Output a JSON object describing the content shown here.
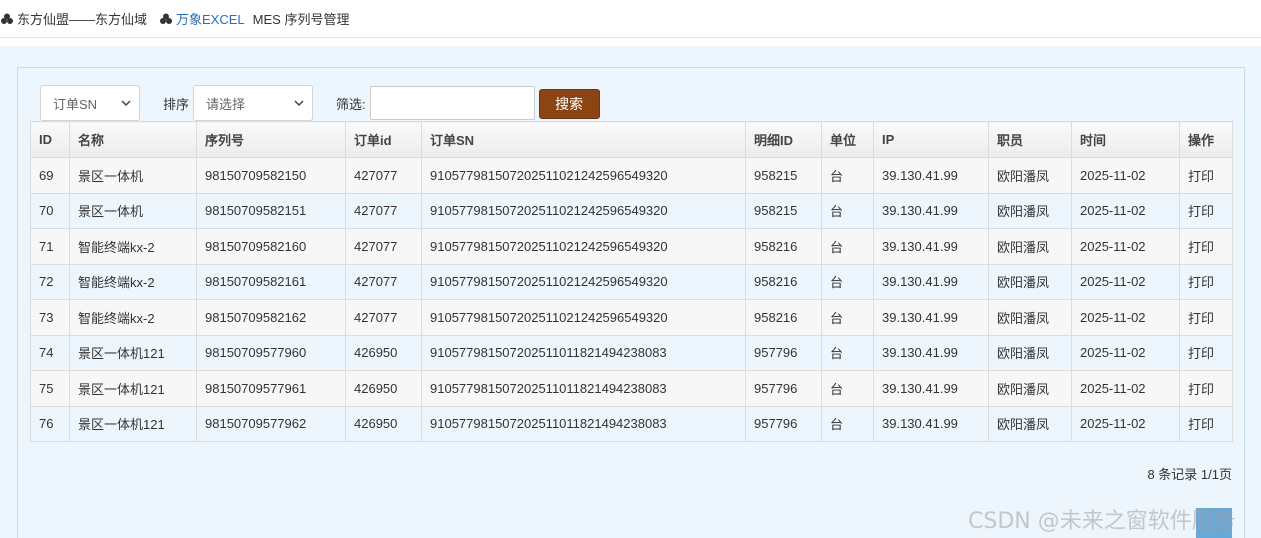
{
  "breadcrumb": {
    "items": [
      {
        "label": "东方仙盟——东方仙域",
        "link": false
      },
      {
        "label": "万象EXCEL",
        "link": true
      },
      {
        "label": "MES 序列号管理",
        "link": false
      }
    ]
  },
  "toolbar": {
    "order_select_value": "订单SN",
    "sort_label": "排序",
    "sort_select_value": "请选择",
    "filter_label": "筛选:",
    "filter_value": "",
    "search_label": "搜索"
  },
  "table": {
    "columns": [
      "ID",
      "名称",
      "序列号",
      "订单id",
      "订单SN",
      "明细ID",
      "单位",
      "IP",
      "职员",
      "时间",
      "操作"
    ],
    "rows": [
      [
        "69",
        "景区一体机",
        "98150709582150",
        "427077",
        "910577981507202511021242596549320",
        "958215",
        "台",
        "39.130.41.99",
        "欧阳潘凤",
        "2025-11-02",
        "打印"
      ],
      [
        "70",
        "景区一体机",
        "98150709582151",
        "427077",
        "910577981507202511021242596549320",
        "958215",
        "台",
        "39.130.41.99",
        "欧阳潘凤",
        "2025-11-02",
        "打印"
      ],
      [
        "71",
        "智能终端kx-2",
        "98150709582160",
        "427077",
        "910577981507202511021242596549320",
        "958216",
        "台",
        "39.130.41.99",
        "欧阳潘凤",
        "2025-11-02",
        "打印"
      ],
      [
        "72",
        "智能终端kx-2",
        "98150709582161",
        "427077",
        "910577981507202511021242596549320",
        "958216",
        "台",
        "39.130.41.99",
        "欧阳潘凤",
        "2025-11-02",
        "打印"
      ],
      [
        "73",
        "智能终端kx-2",
        "98150709582162",
        "427077",
        "910577981507202511021242596549320",
        "958216",
        "台",
        "39.130.41.99",
        "欧阳潘凤",
        "2025-11-02",
        "打印"
      ],
      [
        "74",
        "景区一体机121",
        "98150709577960",
        "426950",
        "910577981507202511011821494238083",
        "957796",
        "台",
        "39.130.41.99",
        "欧阳潘凤",
        "2025-11-02",
        "打印"
      ],
      [
        "75",
        "景区一体机121",
        "98150709577961",
        "426950",
        "910577981507202511011821494238083",
        "957796",
        "台",
        "39.130.41.99",
        "欧阳潘凤",
        "2025-11-02",
        "打印"
      ],
      [
        "76",
        "景区一体机121",
        "98150709577962",
        "426950",
        "910577981507202511011821494238083",
        "957796",
        "台",
        "39.130.41.99",
        "欧阳潘凤",
        "2025-11-02",
        "打印"
      ]
    ]
  },
  "pager": {
    "summary": "8 条记录 1/1页"
  },
  "watermark": "CSDN @未来之窗软件服务",
  "icons": {
    "breadcrumb": "cubes-icon",
    "select_arrow": "chevron-down-icon"
  },
  "colors": {
    "search_button": "#8b4513",
    "link": "#2a6ebb",
    "page_bg": "#eef6fd"
  }
}
